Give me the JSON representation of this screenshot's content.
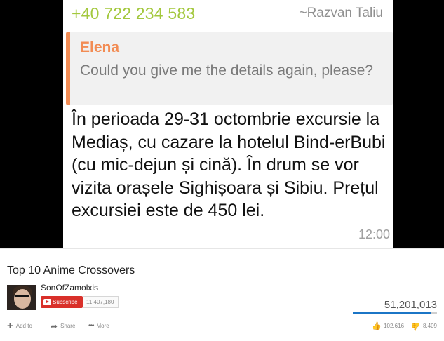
{
  "chat": {
    "sender_phone": "+40 722 234 583",
    "sender_name": "~Razvan Taliu",
    "quote_author": "Elena",
    "quote_text": "Could you give me the details again, please?",
    "message_text": "În perioada 29-31 octombrie excursie la Mediaș, cu cazare la hotelul Bind-erBubi (cu mic-dejun și cină). În drum se vor vizita orașele Sighișoara și Sibiu. Prețul excursiei este de 450 lei.",
    "time": "12:00",
    "colors": {
      "phone": "#a3c83d",
      "quote_accent": "#f28c54"
    }
  },
  "video": {
    "title": "Top 10 Anime Crossovers",
    "channel_name": "SonOfZamolxis",
    "subscribe_label": "Subscribe",
    "subscriber_count": "11,407,180",
    "view_count": "51,201,013",
    "like_ratio": 0.925,
    "actions": {
      "add_label": "Add to",
      "share_label": "Share",
      "more_label": "More"
    },
    "likes": "102,616",
    "dislikes": "8,409",
    "icons": [
      "youtube-logo-icon",
      "add-icon",
      "share-icon",
      "more-icon",
      "thumbs-up-icon",
      "thumbs-down-icon"
    ],
    "colors": {
      "subscribe": "#d9302a",
      "rating_fill": "#1b75c6"
    }
  }
}
